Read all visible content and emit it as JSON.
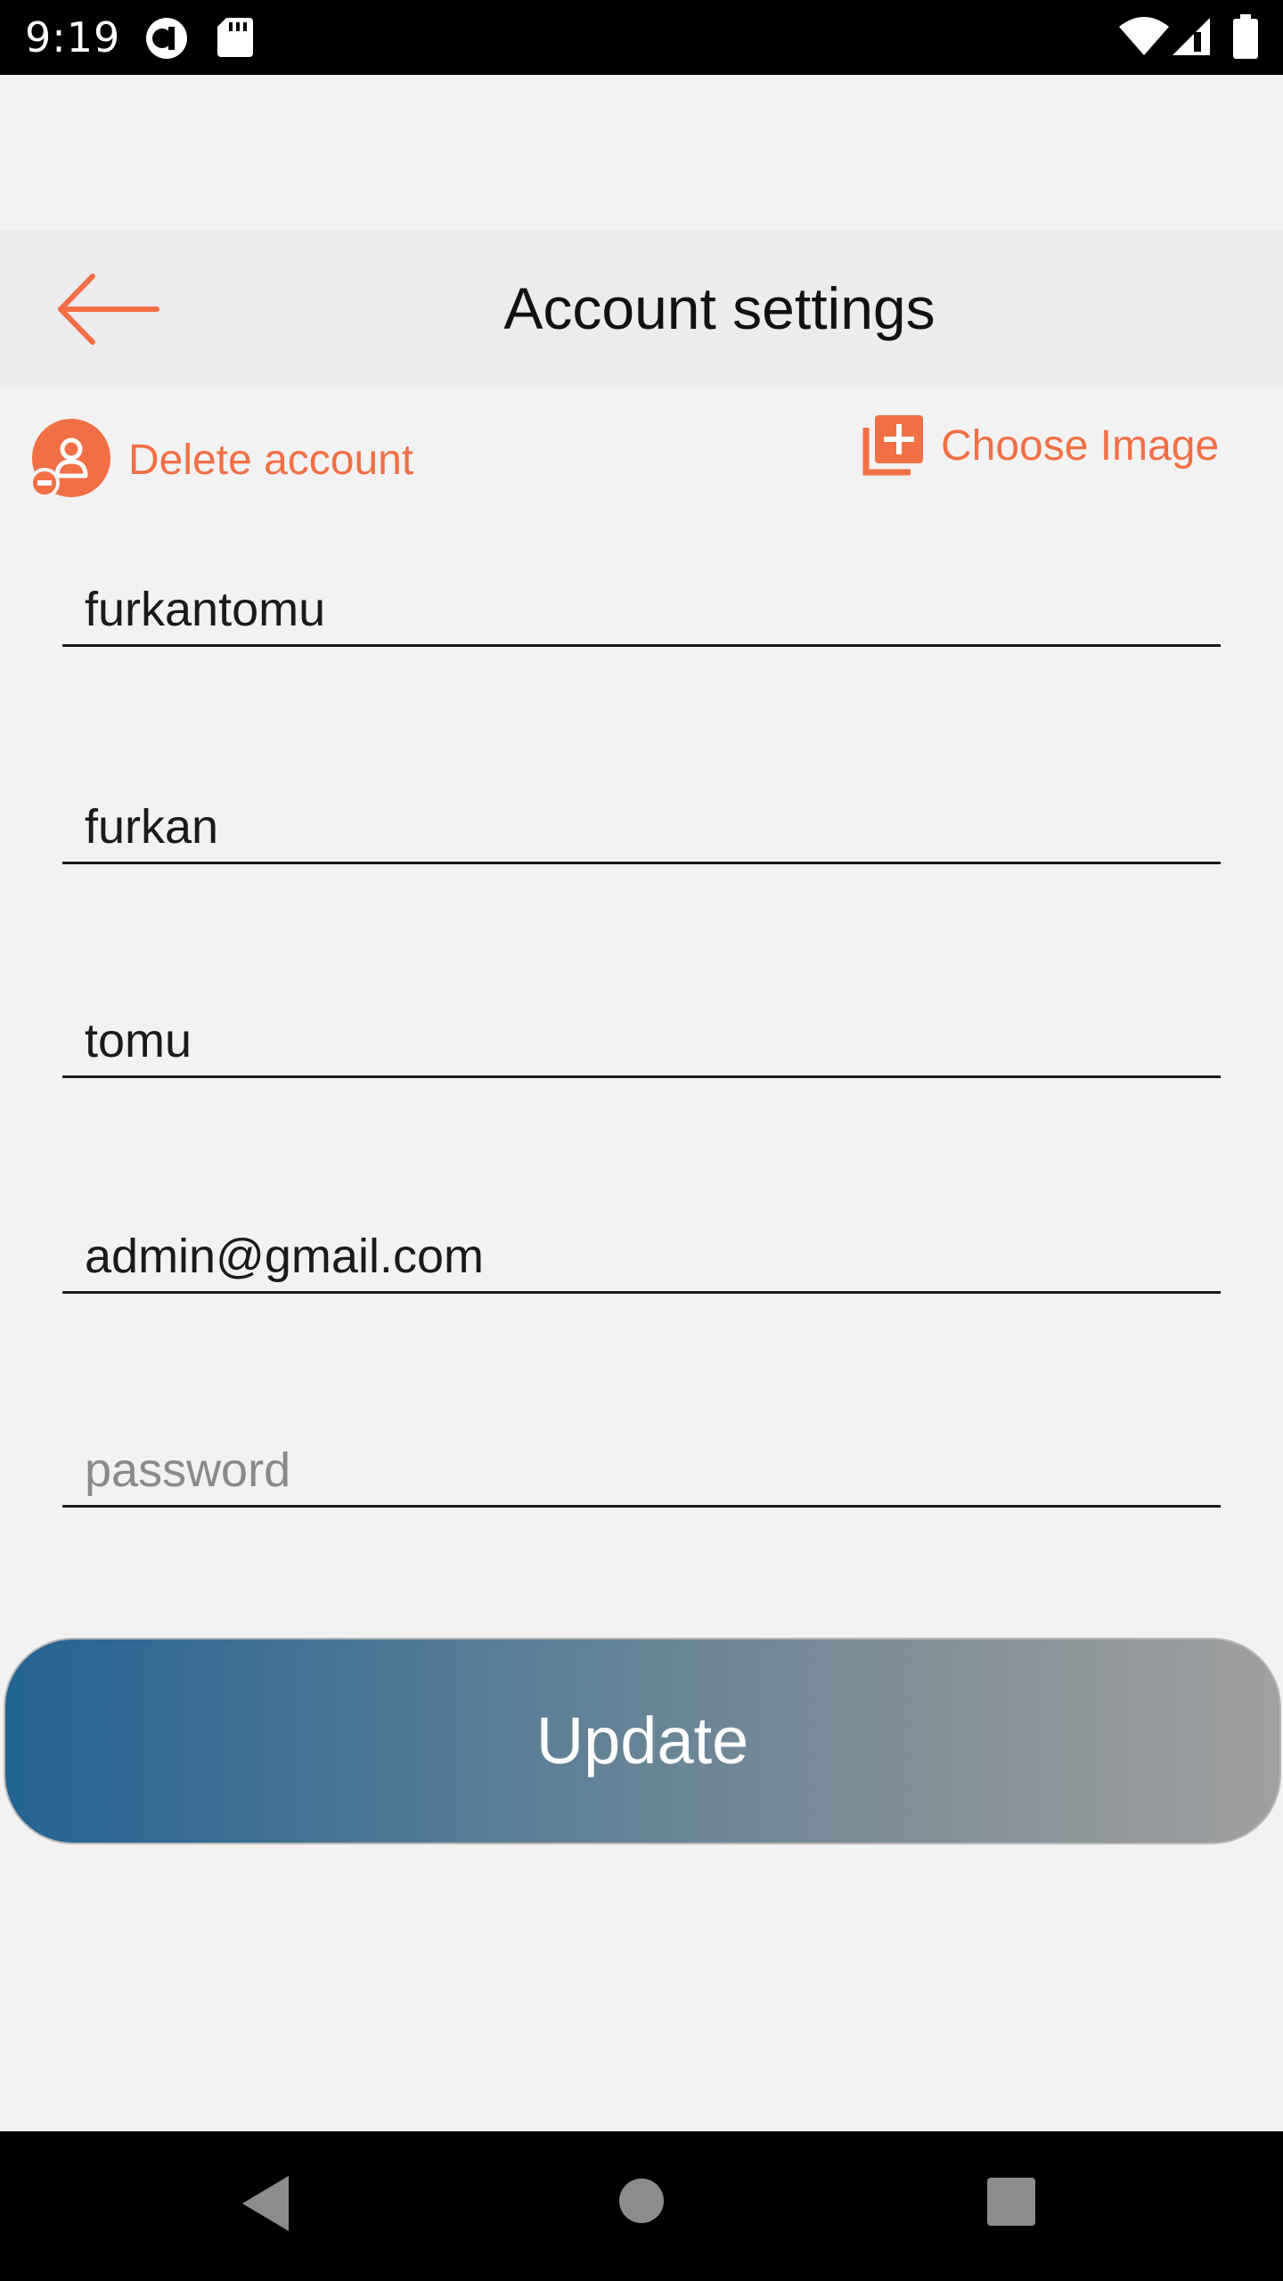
{
  "status_bar": {
    "time": "9:19",
    "icons": [
      "sync-icon",
      "sd-card-icon",
      "wifi-icon",
      "signal-icon",
      "battery-icon"
    ]
  },
  "header": {
    "title": "Account settings",
    "back_icon": "arrow-left-icon"
  },
  "actions": {
    "delete_account_label": "Delete account",
    "delete_account_icon": "remove-user-icon",
    "choose_image_label": "Choose Image",
    "choose_image_icon": "add-to-photos-icon"
  },
  "form": {
    "username": {
      "value": "furkantomu",
      "placeholder": ""
    },
    "first_name": {
      "value": "furkan",
      "placeholder": ""
    },
    "last_name": {
      "value": "tomu",
      "placeholder": ""
    },
    "email": {
      "value": "admin@gmail.com",
      "placeholder": ""
    },
    "password": {
      "value": "",
      "placeholder": "password"
    }
  },
  "update_button": {
    "label": "Update"
  },
  "navigation": {
    "icons": [
      "back-triangle-icon",
      "home-circle-icon",
      "recents-square-icon"
    ]
  },
  "colors": {
    "accent": "#f26f45",
    "button_gradient_start": "#236393",
    "button_gradient_end": "#a0a0a0",
    "background": "#f2f2f3"
  }
}
